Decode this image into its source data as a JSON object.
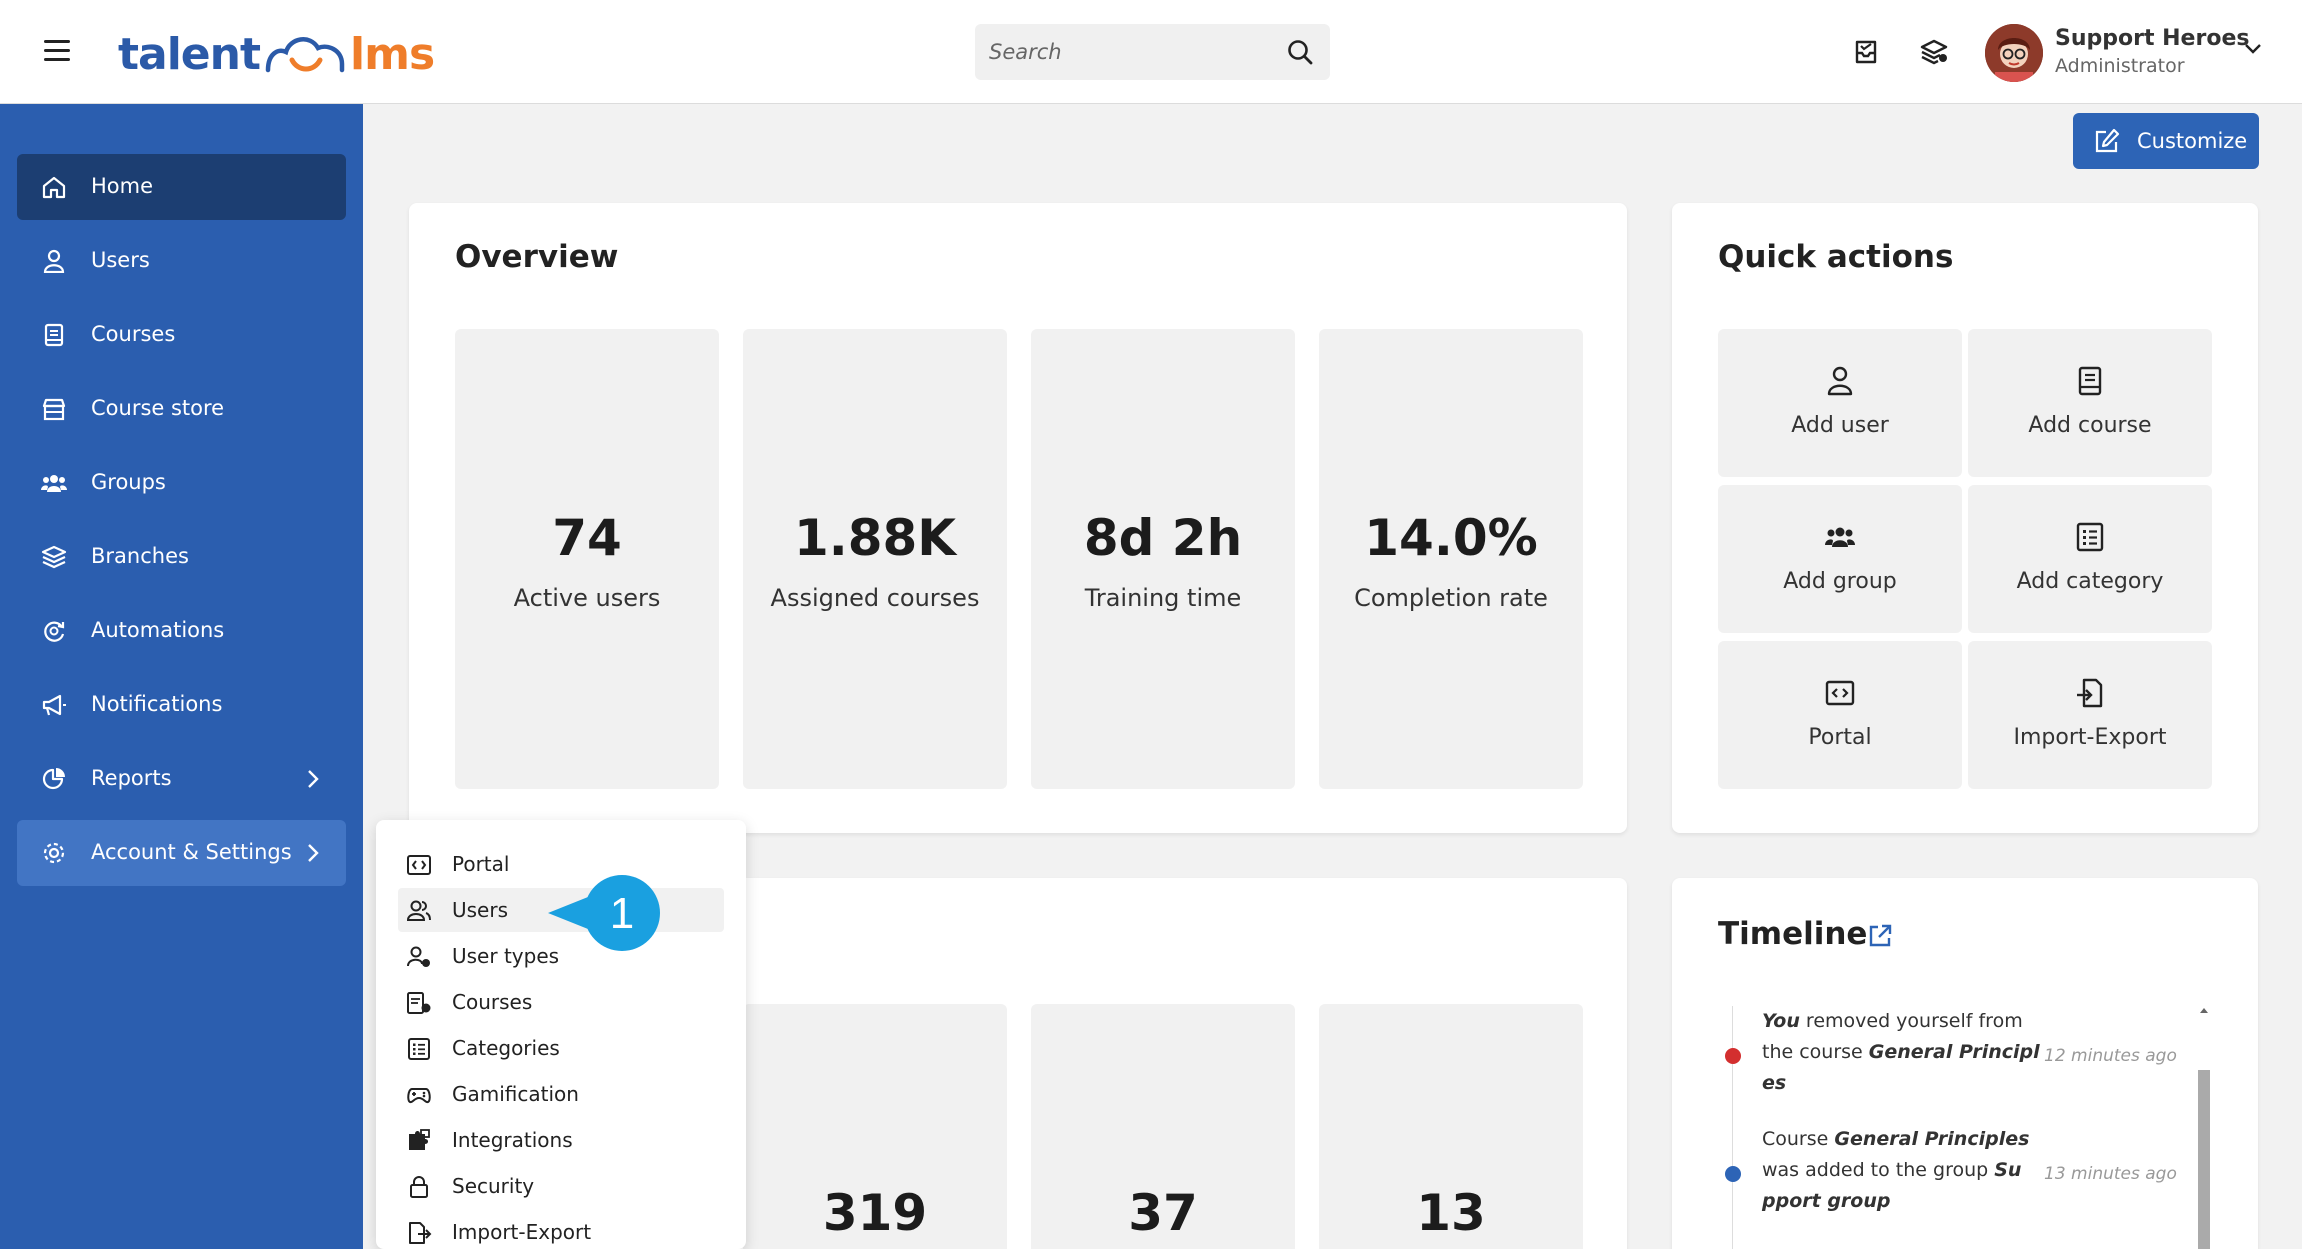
{
  "header": {
    "logo": {
      "left": "talent",
      "right": "lms"
    },
    "search": {
      "placeholder": "Search"
    },
    "icons": [
      "inbox-icon",
      "layers-icon"
    ],
    "user": {
      "name": "Support Heroes",
      "role": "Administrator"
    }
  },
  "sidebar": {
    "items": [
      {
        "label": "Home",
        "icon": "home-icon",
        "state": "active"
      },
      {
        "label": "Users",
        "icon": "user-icon"
      },
      {
        "label": "Courses",
        "icon": "book-icon"
      },
      {
        "label": "Course store",
        "icon": "store-icon"
      },
      {
        "label": "Groups",
        "icon": "groups-icon"
      },
      {
        "label": "Branches",
        "icon": "layers-icon"
      },
      {
        "label": "Automations",
        "icon": "automation-icon"
      },
      {
        "label": "Notifications",
        "icon": "megaphone-icon"
      },
      {
        "label": "Reports",
        "icon": "pie-chart-icon",
        "has_submenu": true
      },
      {
        "label": "Account & Settings",
        "icon": "gear-icon",
        "has_submenu": true,
        "state": "open"
      }
    ]
  },
  "toolbar": {
    "customize_label": "Customize"
  },
  "overview": {
    "title": "Overview",
    "stats": [
      {
        "value": "74",
        "label": "Active users"
      },
      {
        "value": "1.88K",
        "label": "Assigned courses"
      },
      {
        "value": "8d 2h",
        "label": "Training time"
      },
      {
        "value": "14.0%",
        "label": "Completion rate"
      }
    ]
  },
  "quick_actions": {
    "title": "Quick actions",
    "items": [
      {
        "label": "Add user",
        "icon": "user-icon"
      },
      {
        "label": "Add course",
        "icon": "book-icon"
      },
      {
        "label": "Add group",
        "icon": "groups-icon"
      },
      {
        "label": "Add category",
        "icon": "list-icon"
      },
      {
        "label": "Portal",
        "icon": "code-icon"
      },
      {
        "label": "Import-Export",
        "icon": "import-export-icon"
      }
    ]
  },
  "second_stats": {
    "values": [
      "319",
      "37",
      "13"
    ]
  },
  "timeline": {
    "title": "Timeline",
    "entries": [
      {
        "pre": "",
        "actor": "You",
        "mid": " removed yourself from the course ",
        "object": "General Principl es",
        "post": "",
        "time": "12 minutes ago",
        "color": "#d32f2f"
      },
      {
        "pre": "Course ",
        "actor": "General Principles",
        "mid": " was added to the group ",
        "object": "Su pport group",
        "post": "",
        "time": "13 minutes ago",
        "color": "#2d64b6"
      }
    ]
  },
  "account_menu": {
    "items": [
      {
        "label": "Portal",
        "icon": "code-icon"
      },
      {
        "label": "Users",
        "icon": "users-icon",
        "highlighted": true
      },
      {
        "label": "User types",
        "icon": "user-type-icon"
      },
      {
        "label": "Courses",
        "icon": "course-settings-icon"
      },
      {
        "label": "Categories",
        "icon": "list-icon"
      },
      {
        "label": "Gamification",
        "icon": "gamepad-icon"
      },
      {
        "label": "Integrations",
        "icon": "puzzle-icon"
      },
      {
        "label": "Security",
        "icon": "lock-icon"
      },
      {
        "label": "Import-Export",
        "icon": "import-export-icon"
      }
    ]
  },
  "callout": {
    "number": "1",
    "color": "#1aa0e0"
  },
  "colors": {
    "sidebar": "#2b5eaf",
    "sidebar_active": "#1c3e72",
    "accent": "#2d64b6",
    "logo_blue": "#2b5aa8",
    "logo_orange": "#ef7d2a"
  }
}
